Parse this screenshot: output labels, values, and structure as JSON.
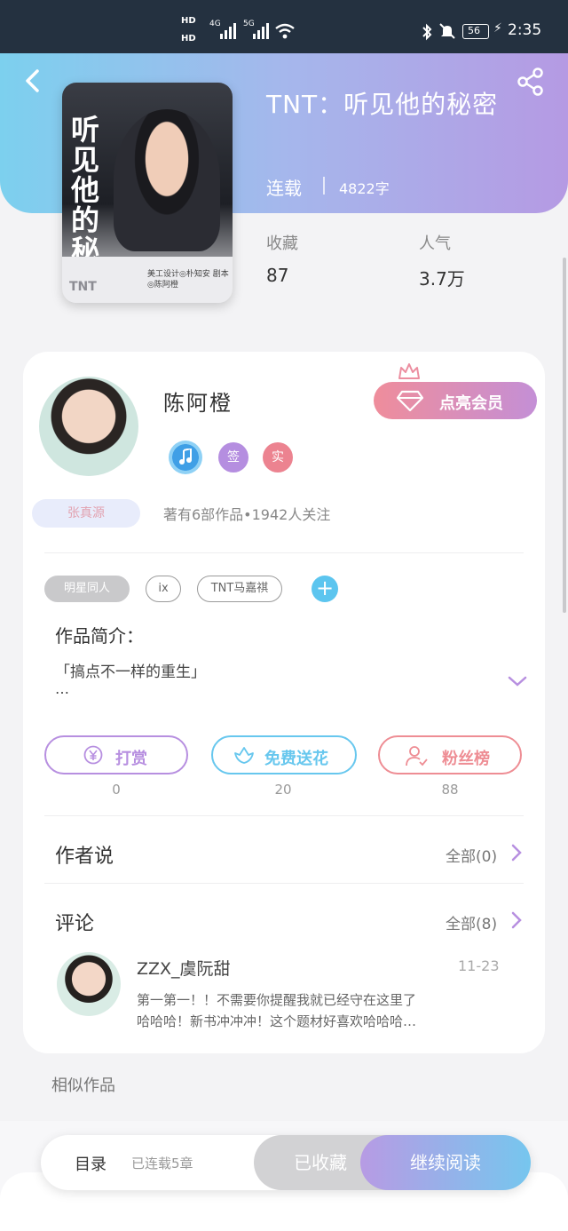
{
  "status_bar": {
    "hd1": "HD",
    "hd2": "HD",
    "net1": "4G",
    "net2": "5G",
    "battery": "56",
    "time": "2:35"
  },
  "book": {
    "title": "TNT：听见他的秘密",
    "serial_status": "连载",
    "word_count": "4822字",
    "cover_title": "听见他的秘密",
    "cover_tag": "TNT",
    "cover_credits": "美工设计◎朴知安 剧本◎陈阿橙",
    "stats": [
      {
        "label": "收藏",
        "value": "87"
      },
      {
        "label": "人气",
        "value": "3.7万"
      }
    ]
  },
  "author": {
    "name": "陈阿橙",
    "vip_label": "点亮会员",
    "badges": [
      {
        "name": "music",
        "text": "",
        "color": "#3f9fe6"
      },
      {
        "name": "signed",
        "text": "签",
        "color": "#b58ee0"
      },
      {
        "name": "verified",
        "text": "实",
        "color": "#ec8390"
      }
    ],
    "fan_tag": "张真源",
    "meta": "著有6部作品•1942人关注"
  },
  "tags": [
    "明星同人",
    "ix",
    "TNT马嘉祺"
  ],
  "intro": {
    "heading": "作品简介：",
    "text": "「搞点不一样的重生」",
    "ellipsis": "…"
  },
  "actions": [
    {
      "label": "打赏",
      "count": "0",
      "color": "#b78fe0",
      "icon": "yen-icon"
    },
    {
      "label": "免费送花",
      "count": "20",
      "color": "#67c7ee",
      "icon": "flower-icon"
    },
    {
      "label": "粉丝榜",
      "count": "88",
      "color": "#ee8d94",
      "icon": "fans-icon"
    }
  ],
  "author_says": {
    "title": "作者说",
    "link": "全部(0)"
  },
  "comments": {
    "title": "评论",
    "link": "全部(8)",
    "items": [
      {
        "user": "ZZX_虞阮甜",
        "date": "11-23",
        "text_line1": "第一第一！！不需要你提醒我就已经守在这里了",
        "text_line2": "哈哈哈！新书冲冲冲！这个题材好喜欢哈哈哈…"
      }
    ]
  },
  "similar_heading": "相似作品",
  "bottom_bar": {
    "toc": "目录",
    "chapters": "已连载5章",
    "collected": "已收藏",
    "continue": "继续阅读"
  }
}
